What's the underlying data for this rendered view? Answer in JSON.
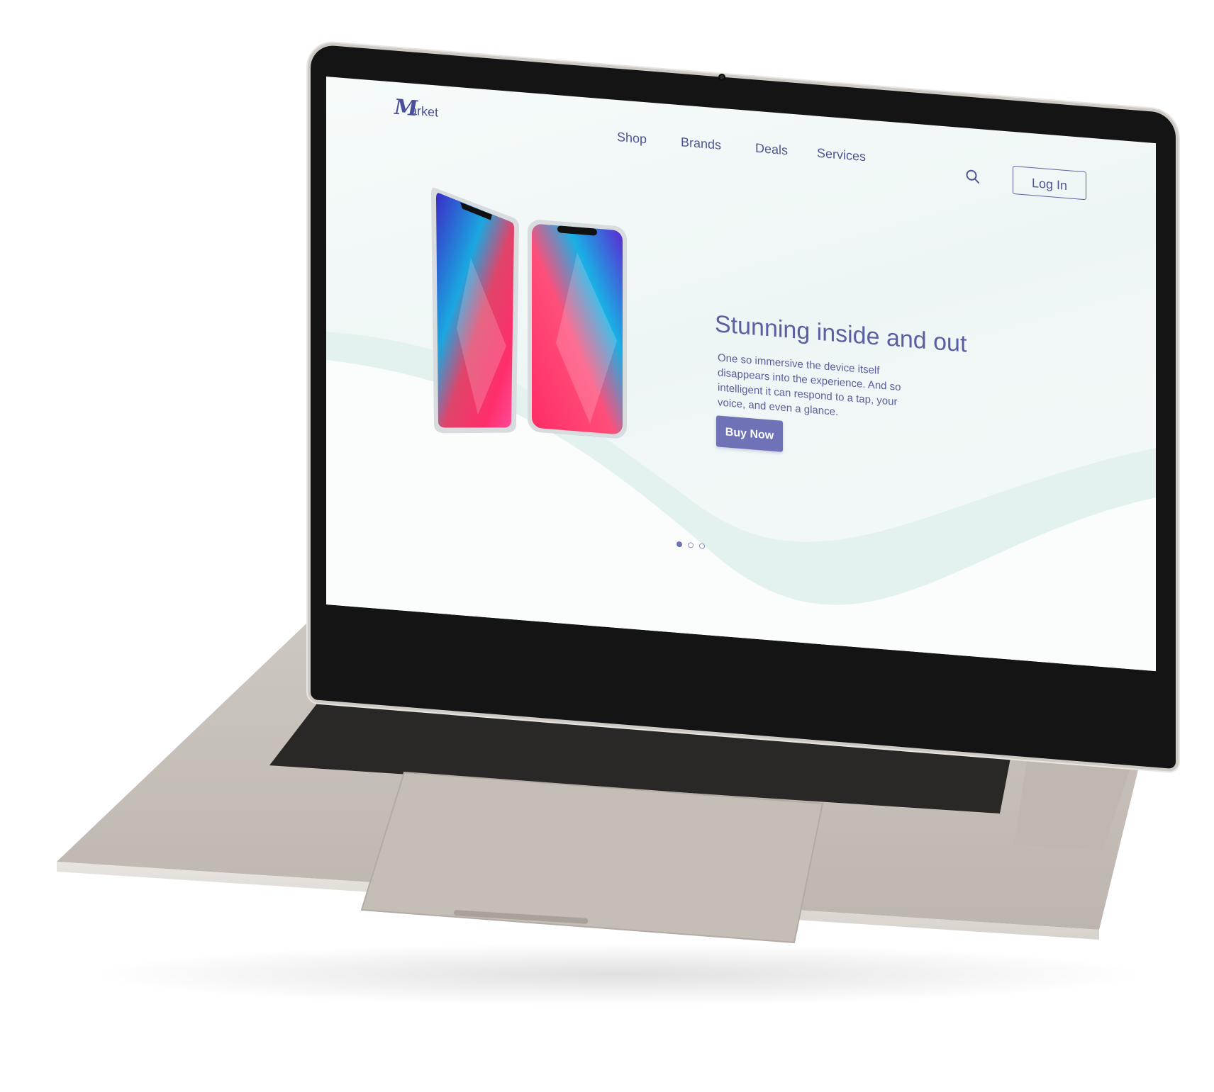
{
  "device": {
    "type": "laptop",
    "body_color": "#c8c2bc",
    "bezel_color": "#141414"
  },
  "site": {
    "brand": {
      "logo_letter": "M",
      "logo_text": "arket",
      "color": "#4b4f9a"
    },
    "nav": {
      "items": [
        {
          "label": "Shop"
        },
        {
          "label": "Brands"
        },
        {
          "label": "Deals"
        },
        {
          "label": "Services"
        }
      ]
    },
    "header": {
      "search_icon": "search-icon",
      "login_label": "Log In"
    },
    "hero": {
      "headline": "Stunning inside and out",
      "body": "One so immersive the device itself disappears into the experience. And so intelligent it can respond to a tap, your voice, and even a glance.",
      "cta_label": "Buy Now",
      "accent": "#6f72b6",
      "image": "two-smartphones"
    },
    "carousel": {
      "slides": 3,
      "active": 1
    }
  }
}
